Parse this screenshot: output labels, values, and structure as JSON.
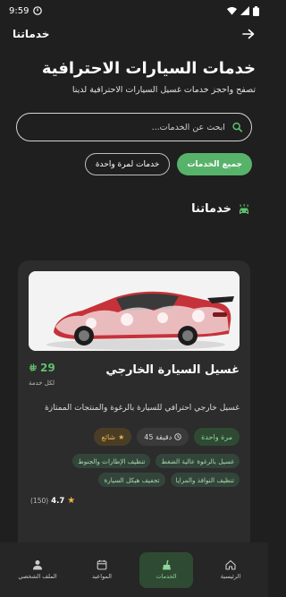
{
  "status_bar": {
    "time": "9:59"
  },
  "app_bar": {
    "title": "خدماتنا"
  },
  "hero": {
    "title": "خدمات السيارات الاحترافية",
    "subtitle": "تصفح واحجز خدمات غسيل السيارات الاحترافية لدينا"
  },
  "search": {
    "placeholder": "ابحث عن الخدمات..."
  },
  "filters": [
    {
      "label": "جميع الخدمات",
      "active": true
    },
    {
      "label": "خدمات لمرة واحدة",
      "active": false
    }
  ],
  "section": {
    "title": "خدماتنا"
  },
  "card": {
    "title": "غسيل السيارة الخارجي",
    "price": "29",
    "price_unit": "لكل خدمة",
    "description": "غسيل خارجي احترافي للسيارة بالرغوة والمنتجات الممتازة",
    "type_badge": "مرة واحدة",
    "duration": "45 دقيقة",
    "popular_badge": "شائع",
    "tags": [
      "غسيل بالرغوة عالية الضغط",
      "تنظيف الإطارات والجنوط",
      "تنظيف النوافذ والمرايا",
      "تجفيف هيكل السيارة"
    ],
    "rating": "4.7",
    "rating_count": "(150)"
  },
  "bottom_nav": [
    {
      "label": "الملف الشخصي",
      "icon": "person-icon",
      "active": false
    },
    {
      "label": "المواعيد",
      "icon": "calendar-icon",
      "active": false
    },
    {
      "label": "الخدمات",
      "icon": "broom-icon",
      "active": true
    },
    {
      "label": "الرئيسية",
      "icon": "home-icon",
      "active": false
    }
  ],
  "colors": {
    "accent": "#57b36a",
    "background": "#1f1f1f",
    "card": "#2c2c2c",
    "amber": "#f1b346"
  }
}
